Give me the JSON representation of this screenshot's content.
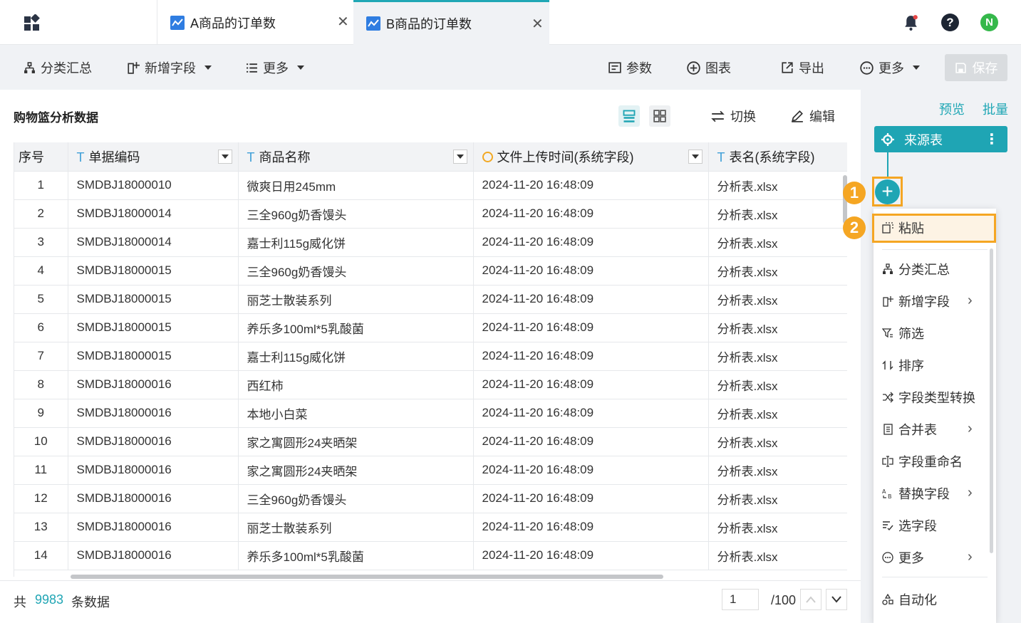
{
  "tabs": [
    {
      "label": "A商品的订单数",
      "active": false
    },
    {
      "label": "B商品的订单数",
      "active": true
    }
  ],
  "header_icons": [
    "bell-icon",
    "help-icon",
    "user-avatar"
  ],
  "user_initial": "N",
  "toolbar": {
    "group_summary": "分类汇总",
    "add_field": "新增字段",
    "more_left": "更多",
    "params": "参数",
    "chart": "图表",
    "export": "导出",
    "more_right": "更多",
    "save": "保存"
  },
  "panel": {
    "title": "购物篮分析数据",
    "switch": "切换",
    "edit": "编辑"
  },
  "table": {
    "columns": [
      "序号",
      "单据编码",
      "商品名称",
      "文件上传时间(系统字段)",
      "表名(系统字段)"
    ],
    "rows": [
      [
        "1",
        "SMDBJ18000010",
        "微爽日用245mm",
        "2024-11-20 16:48:09",
        "分析表.xlsx"
      ],
      [
        "2",
        "SMDBJ18000014",
        "三全960g奶香馒头",
        "2024-11-20 16:48:09",
        "分析表.xlsx"
      ],
      [
        "3",
        "SMDBJ18000014",
        "嘉士利115g威化饼",
        "2024-11-20 16:48:09",
        "分析表.xlsx"
      ],
      [
        "4",
        "SMDBJ18000015",
        "三全960g奶香馒头",
        "2024-11-20 16:48:09",
        "分析表.xlsx"
      ],
      [
        "5",
        "SMDBJ18000015",
        "丽芝士散装系列",
        "2024-11-20 16:48:09",
        "分析表.xlsx"
      ],
      [
        "6",
        "SMDBJ18000015",
        "养乐多100ml*5乳酸菌",
        "2024-11-20 16:48:09",
        "分析表.xlsx"
      ],
      [
        "7",
        "SMDBJ18000015",
        "嘉士利115g威化饼",
        "2024-11-20 16:48:09",
        "分析表.xlsx"
      ],
      [
        "8",
        "SMDBJ18000016",
        "西红柿",
        "2024-11-20 16:48:09",
        "分析表.xlsx"
      ],
      [
        "9",
        "SMDBJ18000016",
        "本地小白菜",
        "2024-11-20 16:48:09",
        "分析表.xlsx"
      ],
      [
        "10",
        "SMDBJ18000016",
        "家之寓圆形24夹晒架",
        "2024-11-20 16:48:09",
        "分析表.xlsx"
      ],
      [
        "11",
        "SMDBJ18000016",
        "家之寓圆形24夹晒架",
        "2024-11-20 16:48:09",
        "分析表.xlsx"
      ],
      [
        "12",
        "SMDBJ18000016",
        "三全960g奶香馒头",
        "2024-11-20 16:48:09",
        "分析表.xlsx"
      ],
      [
        "13",
        "SMDBJ18000016",
        "丽芝士散装系列",
        "2024-11-20 16:48:09",
        "分析表.xlsx"
      ],
      [
        "14",
        "SMDBJ18000016",
        "养乐多100ml*5乳酸菌",
        "2024-11-20 16:48:09",
        "分析表.xlsx"
      ]
    ]
  },
  "footer": {
    "total_prefix": "共",
    "total_count": "9983",
    "total_suffix": "条数据",
    "page_value": "1",
    "page_total": "/100"
  },
  "right_panel": {
    "preview": "预览",
    "batch": "批量",
    "source_node": "来源表",
    "badge1": "1",
    "badge2": "2"
  },
  "menu": {
    "paste": "粘贴",
    "group_summary": "分类汇总",
    "add_field": "新增字段",
    "filter": "筛选",
    "sort": "排序",
    "type_convert": "字段类型转换",
    "merge": "合并表",
    "rename": "字段重命名",
    "replace": "替换字段",
    "select": "选字段",
    "more": "更多",
    "automation": "自动化"
  },
  "colors": {
    "accent": "#1fa5b4",
    "highlight": "#f5a623",
    "chart_blue": "#2f7de1"
  }
}
